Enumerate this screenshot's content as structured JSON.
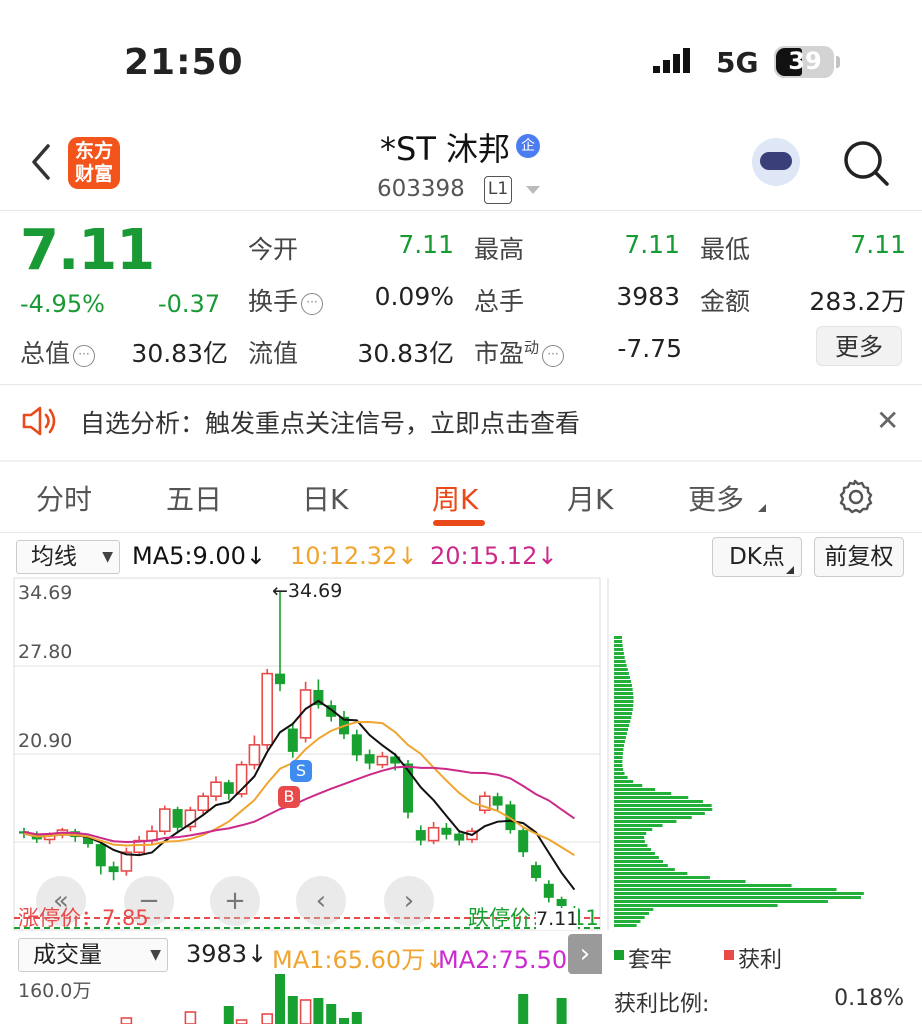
{
  "status": {
    "time": "21:50",
    "network": "5G",
    "battery": "39"
  },
  "header": {
    "logo": "东方财富",
    "stock_name": "*ST 沐邦",
    "qi_badge": "企",
    "stock_code": "603398",
    "level": "L1"
  },
  "quote": {
    "price": "7.11",
    "change_pct": "-4.95%",
    "change": "-0.37",
    "open_label": "今开",
    "open": "7.11",
    "high_label": "最高",
    "high": "7.11",
    "low_label": "最低",
    "low": "7.11",
    "turnover_label": "换手",
    "turnover": "0.09%",
    "volume_label": "总手",
    "volume": "3983",
    "amount_label": "金额",
    "amount": "283.2万",
    "mcap_label": "总值",
    "mcap": "30.83亿",
    "float_label": "流值",
    "float": "30.83亿",
    "pe_label": "市盈",
    "pe_sup": "动",
    "pe": "-7.75",
    "more": "更多"
  },
  "notice": {
    "text": "自选分析：触发重点关注信号，立即点击查看"
  },
  "tabs": [
    "分时",
    "五日",
    "日K",
    "周K",
    "月K",
    "更多"
  ],
  "active_tab": "周K",
  "ma_bar": {
    "indicator": "均线",
    "ma5": "MA5:9.00↓",
    "ma10": "10:12.32↓",
    "ma20": "20:15.12↓",
    "dk": "DK点",
    "adjust": "前复权"
  },
  "chart_data": {
    "type": "candlestick",
    "y_ticks": [
      "34.69",
      "27.80",
      "20.90"
    ],
    "max_marker": "←34.69",
    "limit_up": "涨停价：7.85",
    "limit_down": "跌停价：7.11",
    "last_price_tag": "7.11",
    "signal_b": "B",
    "signal_s": "S",
    "candles": [
      {
        "o": 14.2,
        "c": 14.0,
        "h": 14.5,
        "l": 13.6
      },
      {
        "o": 13.9,
        "c": 13.5,
        "h": 14.2,
        "l": 13.2
      },
      {
        "o": 13.5,
        "c": 13.9,
        "h": 14.1,
        "l": 13.1
      },
      {
        "o": 13.9,
        "c": 14.3,
        "h": 14.5,
        "l": 13.6
      },
      {
        "o": 14.2,
        "c": 13.7,
        "h": 14.4,
        "l": 13.3
      },
      {
        "o": 13.7,
        "c": 13.1,
        "h": 13.9,
        "l": 12.8
      },
      {
        "o": 13.1,
        "c": 11.2,
        "h": 13.3,
        "l": 10.5
      },
      {
        "o": 11.2,
        "c": 10.7,
        "h": 11.6,
        "l": 10.0
      },
      {
        "o": 10.8,
        "c": 12.4,
        "h": 12.8,
        "l": 10.4
      },
      {
        "o": 12.4,
        "c": 13.4,
        "h": 13.8,
        "l": 12.1
      },
      {
        "o": 13.4,
        "c": 14.2,
        "h": 14.7,
        "l": 13.0
      },
      {
        "o": 14.2,
        "c": 16.1,
        "h": 16.4,
        "l": 13.9
      },
      {
        "o": 16.1,
        "c": 14.5,
        "h": 16.3,
        "l": 14.0
      },
      {
        "o": 14.6,
        "c": 16.0,
        "h": 16.3,
        "l": 14.2
      },
      {
        "o": 16.0,
        "c": 17.2,
        "h": 17.5,
        "l": 15.6
      },
      {
        "o": 17.2,
        "c": 18.4,
        "h": 18.9,
        "l": 16.8
      },
      {
        "o": 18.4,
        "c": 17.4,
        "h": 18.6,
        "l": 16.9
      },
      {
        "o": 17.4,
        "c": 19.9,
        "h": 20.2,
        "l": 17.1
      },
      {
        "o": 19.9,
        "c": 21.6,
        "h": 22.4,
        "l": 19.5
      },
      {
        "o": 21.6,
        "c": 27.7,
        "h": 28.1,
        "l": 21.2
      },
      {
        "o": 27.7,
        "c": 26.8,
        "h": 34.69,
        "l": 26.2
      },
      {
        "o": 23.0,
        "c": 21.0,
        "h": 23.5,
        "l": 20.5
      },
      {
        "o": 22.2,
        "c": 26.3,
        "h": 27.0,
        "l": 21.8
      },
      {
        "o": 26.3,
        "c": 25.0,
        "h": 27.2,
        "l": 24.7
      },
      {
        "o": 25.0,
        "c": 24.0,
        "h": 25.4,
        "l": 23.6
      },
      {
        "o": 24.0,
        "c": 22.5,
        "h": 24.5,
        "l": 22.1
      },
      {
        "o": 22.5,
        "c": 20.7,
        "h": 22.9,
        "l": 20.2
      },
      {
        "o": 20.8,
        "c": 20.0,
        "h": 21.2,
        "l": 19.5
      },
      {
        "o": 19.9,
        "c": 20.6,
        "h": 21.0,
        "l": 19.6
      },
      {
        "o": 20.6,
        "c": 20.0,
        "h": 20.9,
        "l": 19.4
      },
      {
        "o": 20.0,
        "c": 15.8,
        "h": 20.3,
        "l": 15.3
      },
      {
        "o": 14.3,
        "c": 13.4,
        "h": 14.7,
        "l": 13.0
      },
      {
        "o": 13.4,
        "c": 14.5,
        "h": 15.0,
        "l": 13.1
      },
      {
        "o": 14.5,
        "c": 13.9,
        "h": 14.9,
        "l": 13.5
      },
      {
        "o": 14.0,
        "c": 13.4,
        "h": 14.3,
        "l": 13.0
      },
      {
        "o": 13.5,
        "c": 14.2,
        "h": 14.5,
        "l": 13.2
      },
      {
        "o": 16.0,
        "c": 17.2,
        "h": 17.6,
        "l": 15.7
      },
      {
        "o": 17.2,
        "c": 16.4,
        "h": 17.5,
        "l": 15.9
      },
      {
        "o": 16.5,
        "c": 14.3,
        "h": 16.8,
        "l": 14.0
      },
      {
        "o": 14.3,
        "c": 12.4,
        "h": 14.6,
        "l": 12.0
      },
      {
        "o": 11.3,
        "c": 10.2,
        "h": 11.6,
        "l": 9.9
      },
      {
        "o": 9.7,
        "c": 8.5,
        "h": 10.0,
        "l": 8.1
      },
      {
        "o": 8.4,
        "c": 7.8,
        "h": 8.6,
        "l": 7.5
      },
      {
        "o": 7.6,
        "c": 7.11,
        "h": 7.8,
        "l": 7.11
      }
    ],
    "y_range": [
      6.6,
      34.69
    ]
  },
  "volume_bar": {
    "indicator": "成交量",
    "vol": "3983↓",
    "ma1": "MA1:65.60万↓",
    "ma2": "MA2:75.50万",
    "top_tick": "160.0万"
  },
  "side_panel": {
    "legend_trap": "套牢",
    "legend_profit": "获利",
    "profit_ratio_label": "获利比例:",
    "profit_ratio": "0.18%"
  },
  "colors": {
    "up": "#e84a4a",
    "down": "#18a030",
    "ma5": "#111111",
    "ma10": "#f0a530",
    "ma20": "#cc2a8a",
    "accent": "#ea4a1a"
  }
}
